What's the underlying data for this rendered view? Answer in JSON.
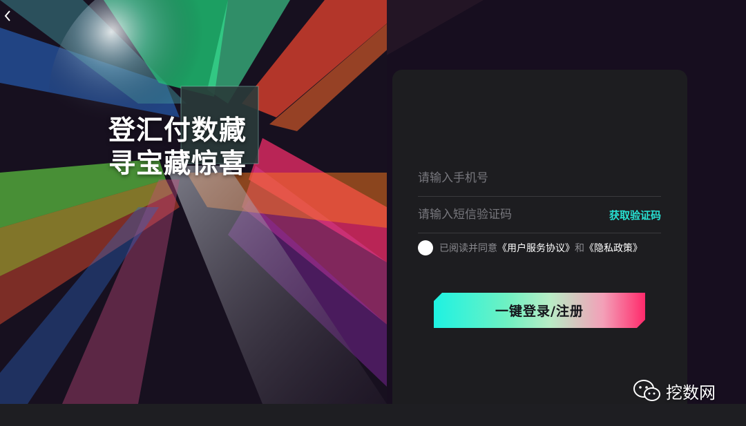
{
  "hero": {
    "slogan_line1": "登汇付数藏",
    "slogan_line2": "寻宝藏惊喜",
    "back_icon": "chevron-left-icon"
  },
  "login": {
    "phone_placeholder": "请输入手机号",
    "code_placeholder": "请输入短信验证码",
    "get_code_label": "获取验证码",
    "agree_prefix": "已阅读并同意",
    "user_agreement": "《用户服务协议》",
    "and_text": "和",
    "privacy_policy": "《隐私政策》",
    "submit_label": "一键登录/注册"
  },
  "watermark": {
    "text": "挖数网",
    "icon": "wechat-icon"
  },
  "colors": {
    "accent_cyan": "#27e0d2",
    "accent_pink": "#ff2a6b",
    "panel_bg": "#1d1d20"
  }
}
